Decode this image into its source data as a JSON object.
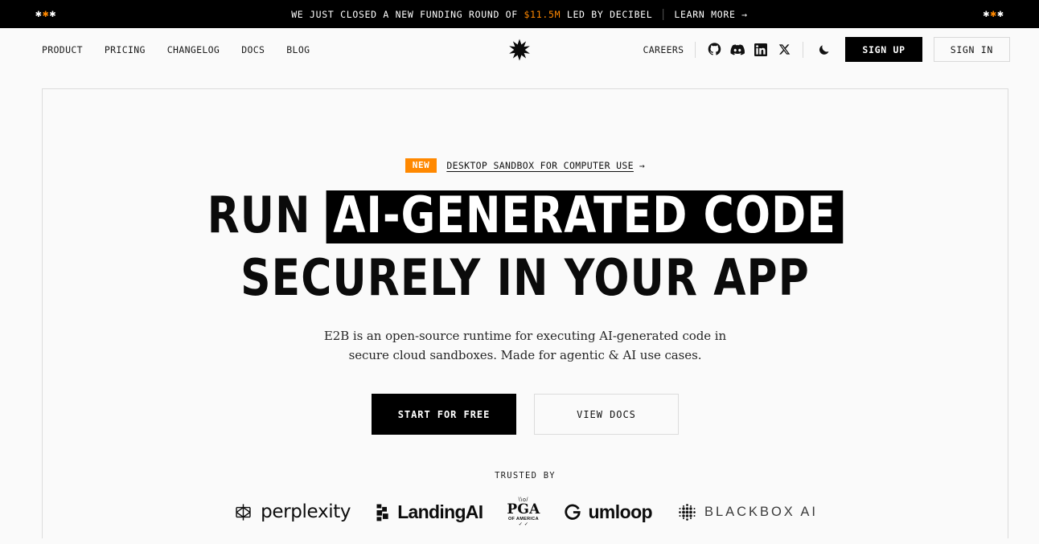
{
  "banner": {
    "asterisks_left": [
      "*",
      "*",
      "*"
    ],
    "asterisks_right": [
      "*",
      "*",
      "*"
    ],
    "message_prefix": "WE JUST CLOSED A NEW FUNDING ROUND OF ",
    "amount": "$11.5M",
    "message_suffix": " LED BY DECIBEL",
    "link_label": "LEARN MORE →",
    "background_color": "#000000",
    "accent_color": "#ff8800"
  },
  "nav": {
    "links": [
      {
        "label": "PRODUCT"
      },
      {
        "label": "PRICING"
      },
      {
        "label": "CHANGELOG"
      },
      {
        "label": "DOCS"
      },
      {
        "label": "BLOG"
      }
    ],
    "logo_name": "e2b-starburst-logo",
    "careers_label": "CAREERS",
    "social": [
      {
        "name": "github-icon",
        "label": "GitHub"
      },
      {
        "name": "discord-icon",
        "label": "Discord"
      },
      {
        "name": "linkedin-icon",
        "label": "LinkedIn"
      },
      {
        "name": "x-twitter-icon",
        "label": "X"
      }
    ],
    "theme_toggle": {
      "name": "moon-icon",
      "label": "Dark mode"
    },
    "signup_label": "SIGN UP",
    "signin_label": "SIGN IN"
  },
  "hero": {
    "badge": "NEW",
    "announcement_link": "DESKTOP SANDBOX FOR COMPUTER USE",
    "announcement_arrow": "→",
    "headline_line1_plain": "RUN",
    "headline_line1_highlight": "AI-GENERATED CODE",
    "headline_line2": "SECURELY IN YOUR APP",
    "subheading": "E2B is an open-source runtime for executing AI-generated code in secure cloud sandboxes. Made for agentic & AI use cases.",
    "cta_primary": "START FOR FREE",
    "cta_secondary": "VIEW DOCS",
    "trusted_label": "TRUSTED BY",
    "logos": [
      {
        "name": "perplexity-logo",
        "label": "perplexity"
      },
      {
        "name": "landingai-logo",
        "label": "LandingAI"
      },
      {
        "name": "pga-of-america-logo",
        "label": "PGA",
        "sub": "OF AMERICA",
        "top": "\\\\o/"
      },
      {
        "name": "gumloop-logo",
        "label": "umloop"
      },
      {
        "name": "blackbox-ai-logo",
        "label": "BLACKBOX AI"
      }
    ]
  },
  "colors": {
    "page_background": "#fafafa",
    "text": "#111111",
    "accent_orange": "#ff8800",
    "border": "#dcdcdc"
  }
}
